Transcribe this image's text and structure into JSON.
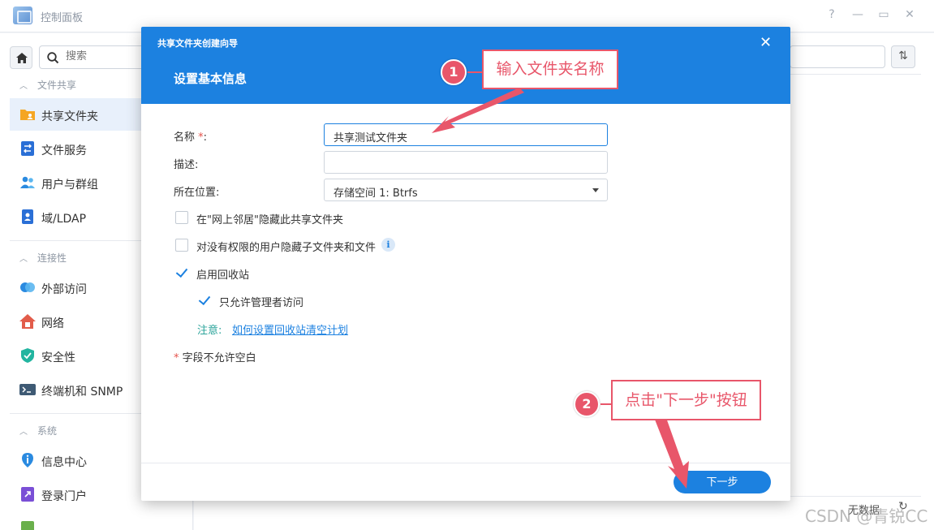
{
  "window": {
    "title": "控制面板",
    "controls": [
      "?",
      "—",
      "▭",
      "✕"
    ]
  },
  "sidebar": {
    "search_placeholder": "搜索",
    "sections": [
      {
        "label": "文件共享"
      },
      {
        "label": "连接性"
      },
      {
        "label": "系统"
      }
    ],
    "items": [
      {
        "label": "共享文件夹",
        "icon": "shared-folder-icon",
        "active": true
      },
      {
        "label": "文件服务",
        "icon": "file-services-icon"
      },
      {
        "label": "用户与群组",
        "icon": "user-group-icon"
      },
      {
        "label": "域/LDAP",
        "icon": "ldap-icon"
      },
      {
        "label": "外部访问",
        "icon": "external-access-icon"
      },
      {
        "label": "网络",
        "icon": "network-icon"
      },
      {
        "label": "安全性",
        "icon": "shield-icon"
      },
      {
        "label": "终端机和 SNMP",
        "icon": "terminal-icon"
      },
      {
        "label": "信息中心",
        "icon": "info-center-icon"
      },
      {
        "label": "登录门户",
        "icon": "login-portal-icon"
      }
    ]
  },
  "main": {
    "status_text": "无数据"
  },
  "dialog": {
    "title": "共享文件夹创建向导",
    "subtitle": "设置基本信息",
    "fields": {
      "name_label": "名称",
      "name_required_mark": "*",
      "name_colon": ":",
      "name_value": "共享测试文件夹",
      "desc_label": "描述:",
      "desc_value": "",
      "location_label": "所在位置:",
      "location_value": "存储空间 1:  Btrfs"
    },
    "options": [
      {
        "label": "在\"网上邻居\"隐藏此共享文件夹",
        "checked": false
      },
      {
        "label": "对没有权限的用户隐藏子文件夹和文件",
        "checked": false,
        "info": "i"
      },
      {
        "label": "启用回收站",
        "checked": true
      },
      {
        "label": "只允许管理者访问",
        "checked": true
      }
    ],
    "note_prefix": "注意:",
    "note_link": "如何设置回收站清空计划",
    "required_mark": "*",
    "required_note": "字段不允许空白",
    "next_button": "下一步"
  },
  "annotations": [
    {
      "number": "1",
      "text": "输入文件夹名称"
    },
    {
      "number": "2",
      "text": "点击\"下一步\"按钮"
    }
  ],
  "colors": {
    "accent": "#1c81e0",
    "annotation": "#e8566a",
    "note": "#2aa39a"
  },
  "watermark": "CSDN @青锐CC"
}
